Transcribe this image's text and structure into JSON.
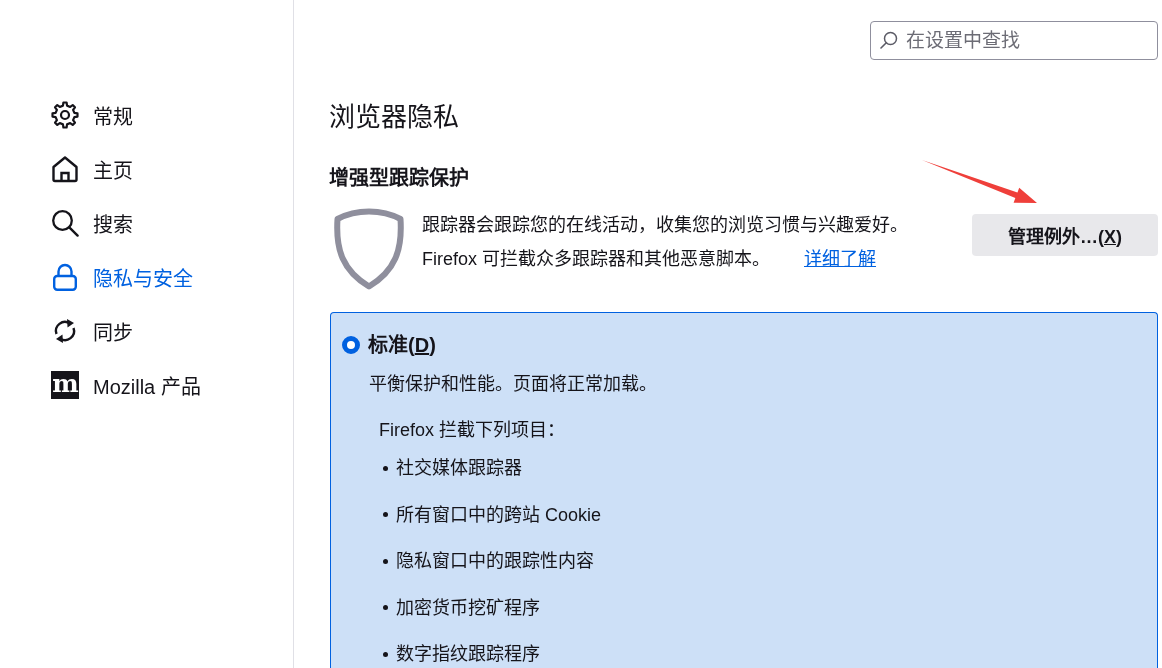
{
  "sidebar": {
    "items": [
      {
        "label": "常规",
        "selected": false
      },
      {
        "label": "主页",
        "selected": false
      },
      {
        "label": "搜索",
        "selected": false
      },
      {
        "label": "隐私与安全",
        "selected": true
      },
      {
        "label": "同步",
        "selected": false
      },
      {
        "label": "Mozilla 产品",
        "logo": "m",
        "selected": false
      }
    ]
  },
  "search": {
    "placeholder": "在设置中查找"
  },
  "page": {
    "title": "浏览器隐私"
  },
  "tracking_protection": {
    "title": "增强型跟踪保护",
    "description": "跟踪器会跟踪您的在线活动，收集您的浏览习惯与兴趣爱好。",
    "note": "Firefox 可拦截众多跟踪器和其他恶意脚本。",
    "link": "详细了解",
    "button": {
      "label_before": "管理例外…(",
      "access_key": "X",
      "label_after": ")"
    }
  },
  "options": [
    {
      "label_before": "标准(",
      "access_key": "D",
      "label_after": ")",
      "selected": true,
      "description": "平衡保护和性能。页面将正常加载。",
      "blocks_title": "Firefox 拦截下列项目：",
      "blocks": [
        "社交媒体跟踪器",
        "所有窗口中的跨站 Cookie",
        "隐私窗口中的跟踪性内容",
        "加密货币挖矿程序",
        "数字指纹跟踪程序"
      ]
    }
  ],
  "annotations": [
    {
      "kind": "arrow"
    }
  ]
}
